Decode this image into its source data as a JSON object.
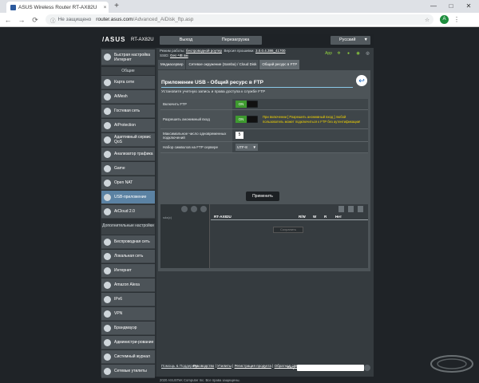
{
  "browser": {
    "tab_title": "ASUS Wireless Router RT-AX82U",
    "tab_close": "×",
    "new_tab": "+",
    "url_insecure": "Не защищено",
    "url_host": "router.asus.com",
    "url_path": "/Advanced_AiDisk_ftp.asp",
    "profile_initial": "A",
    "win_min": "—",
    "win_max": "□",
    "win_close": "✕",
    "back": "←",
    "forward": "→",
    "reload": "⟳",
    "star": "☆",
    "menu": "⋮",
    "info": "ⓘ"
  },
  "router": {
    "logo": "/ASUS",
    "model": "RT-AX82U",
    "logout": "Выход",
    "reboot": "Перезагрузка",
    "language": "Русский",
    "lang_arrow": "▼",
    "status": {
      "mode_label": "Режим работы:",
      "mode_value": "беспроводной роутер",
      "firmware_label": "Версия прошивки:",
      "firmware_value": "3.0.0.4.386_41700",
      "ssid_label": "SSID:",
      "ssid_value": "Gec-ЧВ ам",
      "app_label": "App"
    },
    "sidebar": {
      "quick_setup": "Быстрая настройка Интернет",
      "general_header": "Общие",
      "items": [
        {
          "label": "Карта сети"
        },
        {
          "label": "AiMesh"
        },
        {
          "label": "Гостевая сеть"
        },
        {
          "label": "AiProtection"
        },
        {
          "label": "Адаптивный сервис QoS"
        },
        {
          "label": "Анализатор трафика"
        },
        {
          "label": "Game"
        },
        {
          "label": "Open NAT"
        },
        {
          "label": "USB-приложение"
        },
        {
          "label": "AiCloud 2.0"
        }
      ],
      "advanced_header": "Дополнительные настройки",
      "advanced_items": [
        {
          "label": "Беспроводная сеть"
        },
        {
          "label": "Локальная сеть"
        },
        {
          "label": "Интернет"
        },
        {
          "label": "Amazon Alexa"
        },
        {
          "label": "IPv6"
        },
        {
          "label": "VPN"
        },
        {
          "label": "Брандмауэр"
        },
        {
          "label": "Администри-рование"
        },
        {
          "label": "Системный журнал"
        },
        {
          "label": "Сетевые утилиты"
        }
      ]
    },
    "tabs": [
      {
        "label": "Медиасервер"
      },
      {
        "label": "Сетевое окружение (Samba) / Cloud Disk"
      },
      {
        "label": "Общий ресурс в FTP"
      }
    ],
    "panel": {
      "title": "Приложение USB - Общий ресурс в FTP",
      "description": "Установите учетную запись и права доступа к службе FTP",
      "back_icon": "↩",
      "rows": {
        "enable_ftp": "Включить FTP",
        "anon_login": "Разрешить анонимный вход",
        "max_connections": "Максимальное число одновременных подключений",
        "charset": "Набор символов на FTP сервере"
      },
      "toggle_on": "ON",
      "anon_note": "При включении [ Разрешить анонимный вход ] любой пользователь может подключиться к FTP без аутентификации!",
      "max_connections_value": "5",
      "charset_value": "UTF-8",
      "charset_arrow": "▼",
      "apply": "Применить"
    },
    "share": {
      "tree_item": "sda(c)",
      "device": "RT-AX82U",
      "col_rw": "R/W",
      "col_w": "W",
      "col_r": "R",
      "col_no": "Нет",
      "save": "Сохранить"
    },
    "footer": {
      "help": "Помощь & Поддержка",
      "manual": "Руководство",
      "utilities": "Утилиты",
      "registration": "Регистрация продукта",
      "feedback": "Обратная связь",
      "sep": "|",
      "faq": "FAQ",
      "copyright": "2020 ASUSTeK Computer Inc. Все права защищены."
    }
  },
  "colors": {
    "accent": "#5b82a3",
    "toggle_on": "#3e9a2f",
    "warning": "#f2d300",
    "status_green": "#91d43f"
  }
}
